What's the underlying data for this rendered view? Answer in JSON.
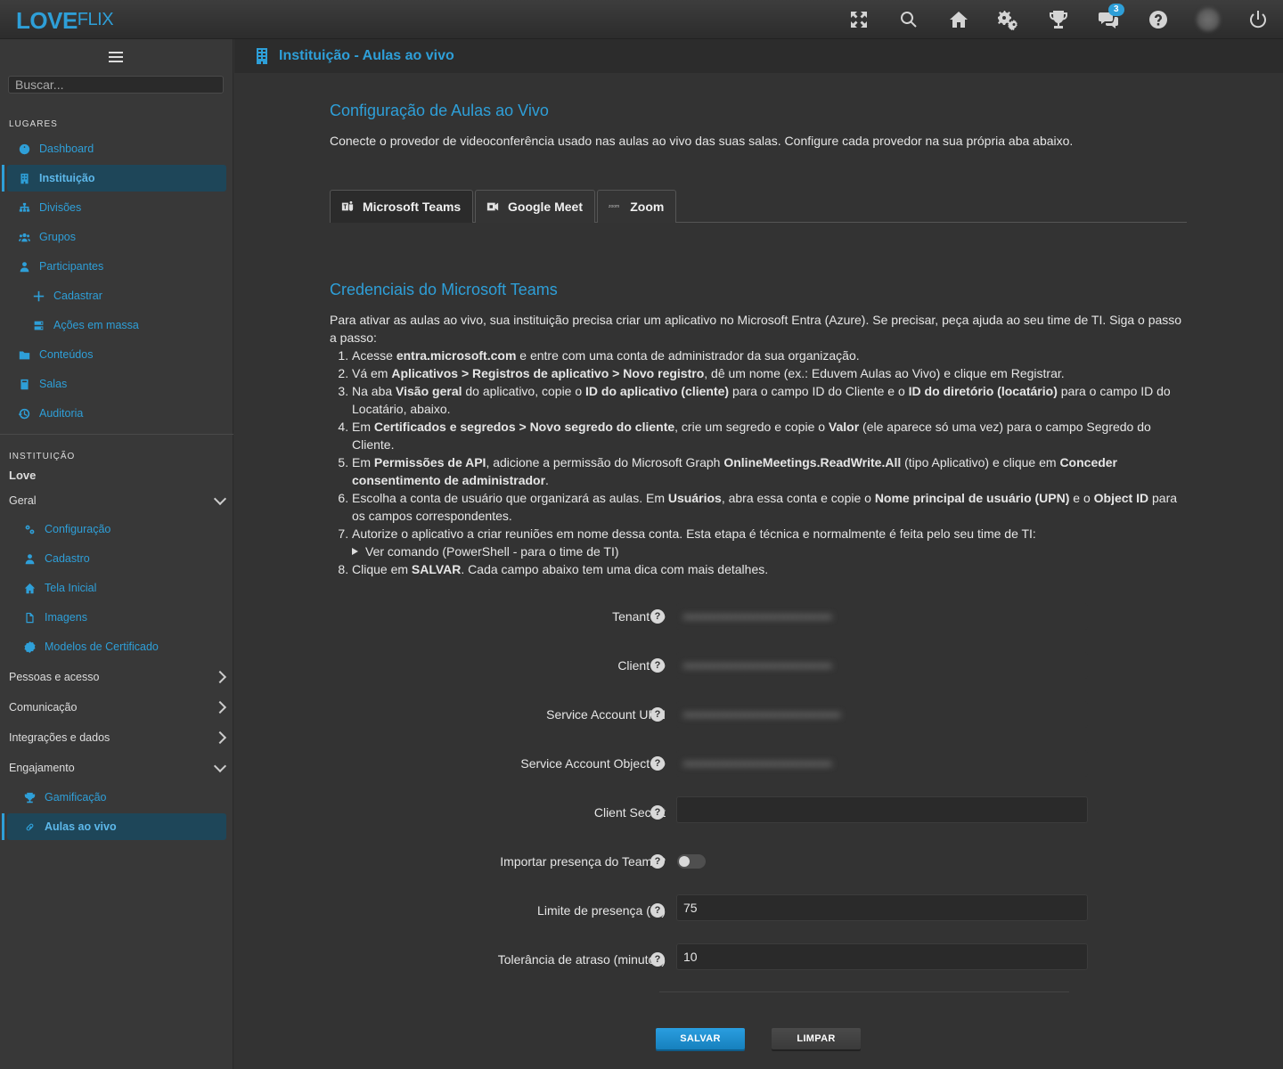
{
  "brand": {
    "love": "LOVE",
    "flix": "FLIX"
  },
  "topbar": {
    "icons": [
      "expand-icon",
      "search-icon",
      "home-icon",
      "gears-icon",
      "trophy-icon",
      "chat-icon",
      "help-icon",
      "avatar",
      "power-icon"
    ],
    "notification_count": "3"
  },
  "sidebar": {
    "search_placeholder": "Buscar...",
    "places_label": "LUGARES",
    "places": [
      {
        "label": "Dashboard",
        "icon": "dashboard-icon"
      },
      {
        "label": "Instituição",
        "icon": "building-icon"
      },
      {
        "label": "Divisões",
        "icon": "sitemap-icon"
      },
      {
        "label": "Grupos",
        "icon": "users-icon"
      },
      {
        "label": "Participantes",
        "icon": "user-icon"
      },
      {
        "label": "Cadastrar",
        "icon": "plus-icon"
      },
      {
        "label": "Ações em massa",
        "icon": "server-icon"
      },
      {
        "label": "Conteúdos",
        "icon": "folder-icon"
      },
      {
        "label": "Salas",
        "icon": "book-icon"
      },
      {
        "label": "Auditoria",
        "icon": "history-icon"
      }
    ],
    "institution_label": "INSTITUIÇÃO",
    "institution_name": "Love",
    "groups": {
      "geral": "Geral",
      "geral_items": [
        {
          "label": "Configuração",
          "icon": "gears-icon"
        },
        {
          "label": "Cadastro",
          "icon": "user-icon"
        },
        {
          "label": "Tela Inicial",
          "icon": "home-icon"
        },
        {
          "label": "Imagens",
          "icon": "file-icon"
        },
        {
          "label": "Modelos de Certificado",
          "icon": "certificate-icon"
        }
      ],
      "pessoas": "Pessoas e acesso",
      "comunicacao": "Comunicação",
      "integracoes": "Integrações e dados",
      "engajamento": "Engajamento",
      "engajamento_items": [
        {
          "label": "Gamificação",
          "icon": "trophy-icon"
        },
        {
          "label": "Aulas ao vivo",
          "icon": "link-icon"
        }
      ]
    }
  },
  "header": {
    "title": "Instituição - Aulas ao vivo"
  },
  "main": {
    "config_title": "Configuração de Aulas ao Vivo",
    "config_desc": "Conecte o provedor de videoconferência usado nas aulas ao vivo das suas salas. Configure cada provedor na sua própria aba abaixo.",
    "tabs": [
      {
        "label": "Microsoft Teams"
      },
      {
        "label": "Google Meet"
      },
      {
        "label": "Zoom",
        "logo": "zoom"
      }
    ],
    "cred_title": "Credenciais do Microsoft Teams",
    "cred_intro": "Para ativar as aulas ao vivo, sua instituição precisa criar um aplicativo no Microsoft Entra (Azure). Se precisar, peça ajuda ao seu time de TI. Siga o passo a passo:",
    "steps": {
      "s1a": "Acesse ",
      "s1b": "entra.microsoft.com",
      "s1c": " e entre com uma conta de administrador da sua organização.",
      "s2a": "Vá em ",
      "s2b": "Aplicativos > Registros de aplicativo > Novo registro",
      "s2c": ", dê um nome (ex.: Eduvem Aulas ao Vivo) e clique em Registrar.",
      "s3a": "Na aba ",
      "s3b": "Visão geral",
      "s3c": " do aplicativo, copie o ",
      "s3d": "ID do aplicativo (cliente)",
      "s3e": " para o campo ID do Cliente e o ",
      "s3f": "ID do diretório (locatário)",
      "s3g": " para o campo ID do Locatário, abaixo.",
      "s4a": "Em ",
      "s4b": "Certificados e segredos > Novo segredo do cliente",
      "s4c": ", crie um segredo e copie o ",
      "s4d": "Valor",
      "s4e": " (ele aparece só uma vez) para o campo Segredo do Cliente.",
      "s5a": "Em ",
      "s5b": "Permissões de API",
      "s5c": ", adicione a permissão do Microsoft Graph ",
      "s5d": "OnlineMeetings.ReadWrite.All",
      "s5e": " (tipo Aplicativo) e clique em ",
      "s5f": "Conceder consentimento de administrador",
      "s5g": ".",
      "s6a": "Escolha a conta de usuário que organizará as aulas. Em ",
      "s6b": "Usuários",
      "s6c": ", abra essa conta e copie o ",
      "s6d": "Nome principal de usuário (UPN)",
      "s6e": " e o ",
      "s6f": "Object ID",
      "s6g": " para os campos correspondentes.",
      "s7a": "Autorize o aplicativo a criar reuniões em nome dessa conta. Esta etapa é técnica e normalmente é feita pelo seu time de TI:",
      "s7details": "Ver comando (PowerShell - para o time de TI)",
      "s8a": "Clique em ",
      "s8b": "SALVAR",
      "s8c": ". Cada campo abaixo tem uma dica com mais detalhes."
    }
  },
  "form": {
    "tenant_label": "Tenant ID",
    "client_label": "Client ID",
    "upn_label": "Service Account UPN",
    "object_label": "Service Account Object ID",
    "secret_label": "Client Secret",
    "secret_value": "",
    "import_label": "Importar presença do Teams?",
    "import_on": false,
    "limit_label": "Limite de presença (%)",
    "limit_value": "75",
    "tolerance_label": "Tolerância de atraso (minutos)",
    "tolerance_value": "10",
    "help_glyph": "?"
  },
  "buttons": {
    "save": "SALVAR",
    "clear": "LIMPAR"
  },
  "colors": {
    "accent": "#2e9fd8",
    "active_bg": "#1e4659"
  }
}
